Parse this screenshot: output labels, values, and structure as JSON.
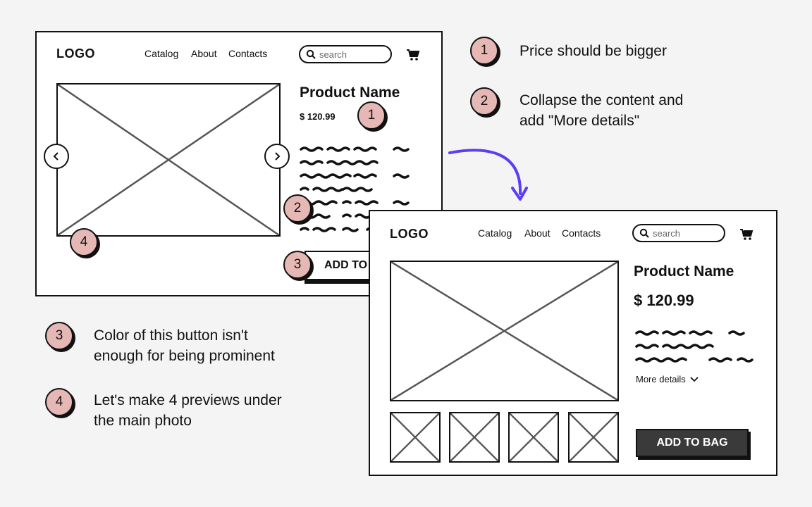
{
  "old_mockup": {
    "logo": "LOGO",
    "nav": [
      "Catalog",
      "About",
      "Contacts"
    ],
    "search_placeholder": "search",
    "product_name": "Product Name",
    "price": "$ 120.99",
    "add_button": "ADD TO"
  },
  "new_mockup": {
    "logo": "LOGO",
    "nav": [
      "Catalog",
      "About",
      "Contacts"
    ],
    "search_placeholder": "search",
    "product_name": "Product Name",
    "price": "$ 120.99",
    "more_details": "More details",
    "add_button": "ADD TO BAG"
  },
  "notes": [
    {
      "number": "1",
      "text_lines": [
        "Price should be bigger"
      ]
    },
    {
      "number": "2",
      "text_lines": [
        "Collapse the content and",
        "add \"More details\""
      ]
    },
    {
      "number": "3",
      "text_lines": [
        "Color of this button isn't",
        "enough for being prominent"
      ]
    },
    {
      "number": "4",
      "text_lines": [
        "Let's make 4 previews under",
        "the main photo"
      ]
    }
  ],
  "markers": [
    "1",
    "2",
    "3",
    "4"
  ],
  "colors": {
    "badge_fill": "#e6b8b5",
    "arrow": "#5b3df5",
    "button_dark": "#3a3a3a"
  },
  "icons": [
    "search-icon",
    "cart-icon",
    "chevron-left-icon",
    "chevron-right-icon",
    "chevron-down-icon",
    "image-placeholder-icon"
  ]
}
